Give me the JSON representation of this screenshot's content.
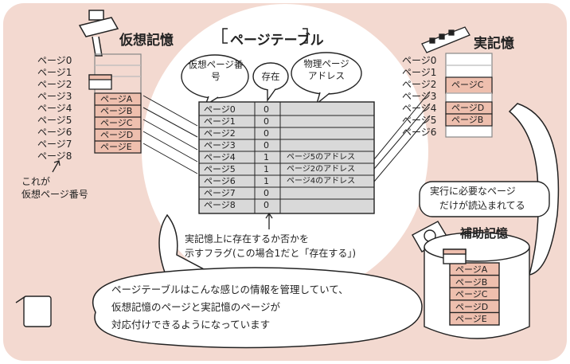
{
  "title": "ページテーブル",
  "virtual_memory": {
    "title": "仮想記憶",
    "page_labels": [
      "ページ0",
      "ページ1",
      "ページ2",
      "ページ3",
      "ページ4",
      "ページ5",
      "ページ6",
      "ページ7",
      "ページ8"
    ],
    "pages_stored": [
      "ページA",
      "ページB",
      "ページC",
      "ページD",
      "ページE"
    ],
    "note_line1": "これが",
    "note_line2": "仮想ページ番号"
  },
  "real_memory": {
    "title": "実記憶",
    "page_labels": [
      "ページ0",
      "ページ1",
      "ページ2",
      "ページ3",
      "ページ4",
      "ページ5",
      "ページ6"
    ],
    "slots": [
      "",
      "",
      "ページC",
      "",
      "ページD",
      "ページB",
      ""
    ]
  },
  "table": {
    "headers": [
      "仮想ページ番号",
      "存在",
      "物理ページアドレス"
    ],
    "rows": [
      {
        "page": "ページ0",
        "exists": "0",
        "address": ""
      },
      {
        "page": "ページ1",
        "exists": "0",
        "address": ""
      },
      {
        "page": "ページ2",
        "exists": "0",
        "address": ""
      },
      {
        "page": "ページ3",
        "exists": "0",
        "address": ""
      },
      {
        "page": "ページ4",
        "exists": "1",
        "address": "ページ5のアドレス"
      },
      {
        "page": "ページ5",
        "exists": "1",
        "address": "ページ2のアドレス"
      },
      {
        "page": "ページ6",
        "exists": "1",
        "address": "ページ4のアドレス"
      },
      {
        "page": "ページ7",
        "exists": "0",
        "address": ""
      },
      {
        "page": "ページ8",
        "exists": "0",
        "address": ""
      }
    ]
  },
  "flag_note_line1": "実記憶上に存在するか否かを",
  "flag_note_line2": "示すフラグ(この場合1だと「存在する」)",
  "execution_note_line1": "実行に必要なページ",
  "execution_note_line2": "だけが読込まれてる",
  "auxiliary_memory": {
    "title": "補助記憶",
    "pages": [
      "ページA",
      "ページB",
      "ページC",
      "ページD",
      "ページE"
    ]
  },
  "main_note_line1": "ページテーブルはこんな感じの情報を管理していて、",
  "main_note_line2": "仮想記憶のページと実記憶のページが",
  "main_note_line3": "対応付けできるようになっています",
  "colors": {
    "background": "#f3d9d0",
    "highlight": "#eebfae",
    "table_fill": "#d9d9d9",
    "line": "#222222"
  }
}
